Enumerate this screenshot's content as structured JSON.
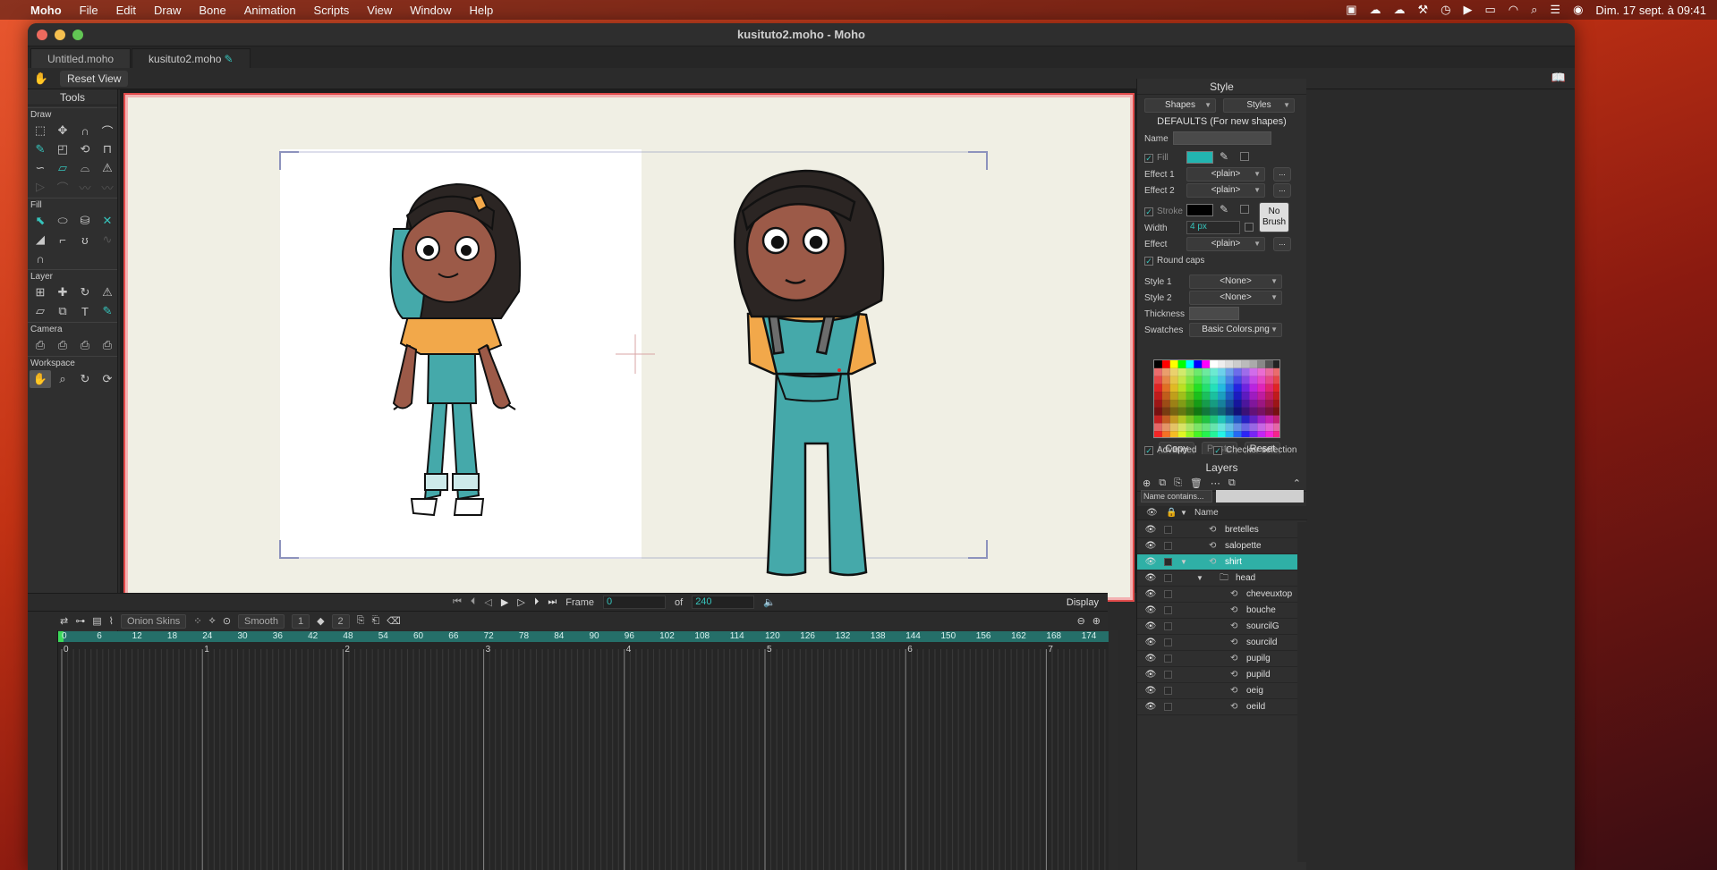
{
  "menubar": {
    "app": "Moho",
    "items": [
      "File",
      "Edit",
      "Draw",
      "Bone",
      "Animation",
      "Scripts",
      "View",
      "Window",
      "Help"
    ],
    "clock": "Dim. 17 sept. à 09:41"
  },
  "window": {
    "title": "kusituto2.moho - Moho",
    "tabs": [
      "Untitled.moho",
      "kusituto2.moho"
    ]
  },
  "toolbar": {
    "reset_view": "Reset View"
  },
  "tools": {
    "title": "Tools",
    "sections": [
      "Draw",
      "Fill",
      "Layer",
      "Camera",
      "Workspace"
    ]
  },
  "transport": {
    "frame_label": "Frame",
    "frame_value": "0",
    "of_label": "of",
    "total_frames": "240",
    "display_label": "Display"
  },
  "timeline_options": {
    "onion_skins": "Onion Skins",
    "interpolation": "Smooth",
    "step": "1",
    "keys": "2"
  },
  "timeline": {
    "ruler": [
      "0",
      "6",
      "12",
      "18",
      "24",
      "30",
      "36",
      "42",
      "48",
      "54",
      "60",
      "66",
      "72",
      "78",
      "84",
      "90",
      "96",
      "102",
      "108",
      "114",
      "120",
      "126",
      "132",
      "138",
      "144",
      "150",
      "156",
      "162",
      "168",
      "174"
    ],
    "seconds": [
      "0",
      "1",
      "2",
      "3",
      "4",
      "5",
      "6",
      "7"
    ]
  },
  "style": {
    "title": "Style",
    "shapes_label": "Shapes",
    "styles_label": "Styles",
    "defaults_label": "DEFAULTS (For new shapes)",
    "name_label": "Name",
    "fill_label": "Fill",
    "effect1_label": "Effect 1",
    "effect1_value": "<plain>",
    "effect2_label": "Effect 2",
    "effect2_value": "<plain>",
    "stroke_label": "Stroke",
    "width_label": "Width",
    "width_value": "4 px",
    "no_brush_label": "No\nBrush",
    "effect_label": "Effect",
    "effect_value": "<plain>",
    "round_caps_label": "Round caps",
    "style1_label": "Style 1",
    "style1_value": "<None>",
    "style2_label": "Style 2",
    "style2_value": "<None>",
    "thickness_label": "Thickness",
    "swatches_label": "Swatches",
    "swatches_value": "Basic Colors.png",
    "copy_label": "Copy",
    "paste_label": "Paste",
    "reset_label": "Reset",
    "advanced_label": "Advanced",
    "checker_label": "Checker selection",
    "fill_color": "#22b5b0",
    "stroke_color": "#000000",
    "more_label": "..."
  },
  "layers": {
    "title": "Layers",
    "filter_label": "Name contains...",
    "name_col": "Name",
    "rows": [
      {
        "name": "bretelles",
        "indent": 0,
        "type": "vector",
        "selected": false
      },
      {
        "name": "salopette",
        "indent": 0,
        "type": "vector",
        "selected": false
      },
      {
        "name": "shirt",
        "indent": 0,
        "type": "vector",
        "selected": true
      },
      {
        "name": "head",
        "indent": 1,
        "type": "group",
        "selected": false
      },
      {
        "name": "cheveuxtop",
        "indent": 2,
        "type": "vector",
        "selected": false
      },
      {
        "name": "bouche",
        "indent": 2,
        "type": "vector",
        "selected": false
      },
      {
        "name": "sourcilG",
        "indent": 2,
        "type": "vector",
        "selected": false
      },
      {
        "name": "sourcild",
        "indent": 2,
        "type": "vector",
        "selected": false
      },
      {
        "name": "pupilg",
        "indent": 2,
        "type": "vector",
        "selected": false
      },
      {
        "name": "pupild",
        "indent": 2,
        "type": "vector",
        "selected": false
      },
      {
        "name": "oeig",
        "indent": 2,
        "type": "vector",
        "selected": false
      },
      {
        "name": "oeild",
        "indent": 2,
        "type": "vector",
        "selected": false
      }
    ]
  },
  "colors": {
    "accent": "#2fb0a6",
    "ruler": "#256f69",
    "stage_border": "#e24b4b",
    "stage_bg": "#f0efe4",
    "overalls": "#45a9aa",
    "shirt": "#f2a84a",
    "skin": "#9c5a48",
    "hair": "#2b2523"
  }
}
